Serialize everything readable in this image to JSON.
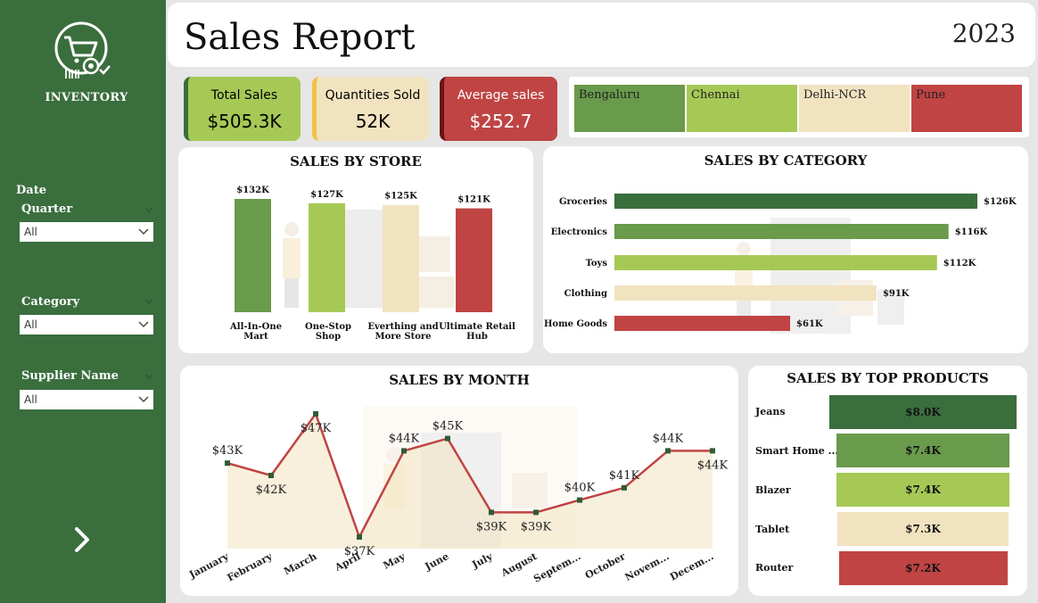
{
  "colors": {
    "dark_green": "#3a6e3d",
    "mid_green": "#6a9a4c",
    "light_green": "#a6c956",
    "beige": "#f2e3c0",
    "red": "#c04444",
    "gold": "#f2c244"
  },
  "sidebar": {
    "logo_label": "INVENTORY",
    "date_heading": "Date",
    "quarter_label": "Quarter",
    "quarter_value": "All",
    "category_label": "Category",
    "category_value": "All",
    "supplier_label": "Supplier Name",
    "supplier_value": "All"
  },
  "header": {
    "title": "Sales Report",
    "year": "2023"
  },
  "kpis": [
    {
      "label": "Total Sales",
      "value": "$505.3K"
    },
    {
      "label": "Quantities Sold",
      "value": "52K"
    },
    {
      "label": "Average sales",
      "value": "$252.7"
    }
  ],
  "cities": [
    "Bengaluru",
    "Chennai",
    "Delhi-NCR",
    "Pune"
  ],
  "panels": {
    "store_title": "SALES BY STORE",
    "category_title": "SALES BY CATEGORY",
    "month_title": "SALES BY MONTH",
    "products_title": "SALES BY TOP PRODUCTS"
  },
  "chart_data": [
    {
      "type": "bar",
      "title": "SALES BY STORE",
      "categories": [
        "All-In-One Mart",
        "One-Stop Shop",
        "Everthing and More Store",
        "Ultimate Retail Hub"
      ],
      "values": [
        132,
        127,
        125,
        121
      ],
      "data_labels": [
        "$132K",
        "$127K",
        "$125K",
        "$121K"
      ],
      "colors": [
        "#6a9a4c",
        "#a6c956",
        "#f2e3c0",
        "#c04444"
      ],
      "ylim": [
        0,
        140
      ]
    },
    {
      "type": "bar",
      "orientation": "horizontal",
      "title": "SALES BY CATEGORY",
      "categories": [
        "Groceries",
        "Electronics",
        "Toys",
        "Clothing",
        "Home Goods"
      ],
      "values": [
        126,
        116,
        112,
        91,
        61
      ],
      "data_labels": [
        "$126K",
        "$116K",
        "$112K",
        "$91K",
        "$61K"
      ],
      "colors": [
        "#3a6e3d",
        "#6a9a4c",
        "#a6c956",
        "#f2e3c0",
        "#c04444"
      ]
    },
    {
      "type": "line",
      "title": "SALES BY MONTH",
      "categories": [
        "January",
        "February",
        "March",
        "April",
        "May",
        "June",
        "July",
        "August",
        "Septem...",
        "October",
        "Novem...",
        "Decem..."
      ],
      "values": [
        43,
        42,
        47,
        37,
        44,
        45,
        39,
        39,
        40,
        41,
        44,
        44
      ],
      "data_labels": [
        "$43K",
        "$42K",
        "$47K",
        "$37K",
        "$44K",
        "$45K",
        "$39K",
        "$39K",
        "$40K",
        "$41K",
        "$44K",
        "$44K"
      ],
      "ylim": [
        35,
        48
      ]
    },
    {
      "type": "bar",
      "orientation": "horizontal",
      "title": "SALES BY TOP PRODUCTS",
      "categories": [
        "Jeans",
        "Smart Home ...",
        "Blazer",
        "Tablet",
        "Router"
      ],
      "values": [
        8.0,
        7.4,
        7.4,
        7.3,
        7.2
      ],
      "data_labels": [
        "$8.0K",
        "$7.4K",
        "$7.4K",
        "$7.3K",
        "$7.2K"
      ],
      "colors": [
        "#3a6e3d",
        "#6a9a4c",
        "#a6c956",
        "#f2e3c0",
        "#c04444"
      ]
    }
  ]
}
